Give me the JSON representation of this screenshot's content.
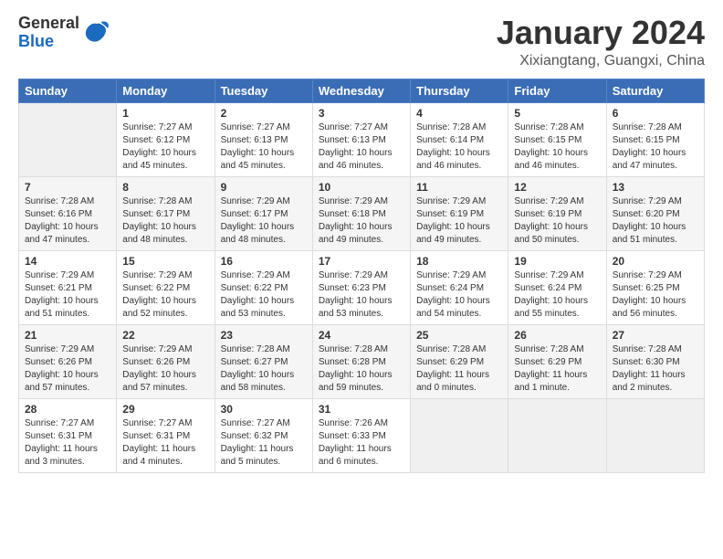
{
  "header": {
    "logo": {
      "line1": "General",
      "line2": "Blue"
    },
    "month_year": "January 2024",
    "location": "Xixiangtang, Guangxi, China"
  },
  "weekdays": [
    "Sunday",
    "Monday",
    "Tuesday",
    "Wednesday",
    "Thursday",
    "Friday",
    "Saturday"
  ],
  "weeks": [
    [
      {
        "num": "",
        "info": ""
      },
      {
        "num": "1",
        "info": "Sunrise: 7:27 AM\nSunset: 6:12 PM\nDaylight: 10 hours\nand 45 minutes."
      },
      {
        "num": "2",
        "info": "Sunrise: 7:27 AM\nSunset: 6:13 PM\nDaylight: 10 hours\nand 45 minutes."
      },
      {
        "num": "3",
        "info": "Sunrise: 7:27 AM\nSunset: 6:13 PM\nDaylight: 10 hours\nand 46 minutes."
      },
      {
        "num": "4",
        "info": "Sunrise: 7:28 AM\nSunset: 6:14 PM\nDaylight: 10 hours\nand 46 minutes."
      },
      {
        "num": "5",
        "info": "Sunrise: 7:28 AM\nSunset: 6:15 PM\nDaylight: 10 hours\nand 46 minutes."
      },
      {
        "num": "6",
        "info": "Sunrise: 7:28 AM\nSunset: 6:15 PM\nDaylight: 10 hours\nand 47 minutes."
      }
    ],
    [
      {
        "num": "7",
        "info": "Sunrise: 7:28 AM\nSunset: 6:16 PM\nDaylight: 10 hours\nand 47 minutes."
      },
      {
        "num": "8",
        "info": "Sunrise: 7:28 AM\nSunset: 6:17 PM\nDaylight: 10 hours\nand 48 minutes."
      },
      {
        "num": "9",
        "info": "Sunrise: 7:29 AM\nSunset: 6:17 PM\nDaylight: 10 hours\nand 48 minutes."
      },
      {
        "num": "10",
        "info": "Sunrise: 7:29 AM\nSunset: 6:18 PM\nDaylight: 10 hours\nand 49 minutes."
      },
      {
        "num": "11",
        "info": "Sunrise: 7:29 AM\nSunset: 6:19 PM\nDaylight: 10 hours\nand 49 minutes."
      },
      {
        "num": "12",
        "info": "Sunrise: 7:29 AM\nSunset: 6:19 PM\nDaylight: 10 hours\nand 50 minutes."
      },
      {
        "num": "13",
        "info": "Sunrise: 7:29 AM\nSunset: 6:20 PM\nDaylight: 10 hours\nand 51 minutes."
      }
    ],
    [
      {
        "num": "14",
        "info": "Sunrise: 7:29 AM\nSunset: 6:21 PM\nDaylight: 10 hours\nand 51 minutes."
      },
      {
        "num": "15",
        "info": "Sunrise: 7:29 AM\nSunset: 6:22 PM\nDaylight: 10 hours\nand 52 minutes."
      },
      {
        "num": "16",
        "info": "Sunrise: 7:29 AM\nSunset: 6:22 PM\nDaylight: 10 hours\nand 53 minutes."
      },
      {
        "num": "17",
        "info": "Sunrise: 7:29 AM\nSunset: 6:23 PM\nDaylight: 10 hours\nand 53 minutes."
      },
      {
        "num": "18",
        "info": "Sunrise: 7:29 AM\nSunset: 6:24 PM\nDaylight: 10 hours\nand 54 minutes."
      },
      {
        "num": "19",
        "info": "Sunrise: 7:29 AM\nSunset: 6:24 PM\nDaylight: 10 hours\nand 55 minutes."
      },
      {
        "num": "20",
        "info": "Sunrise: 7:29 AM\nSunset: 6:25 PM\nDaylight: 10 hours\nand 56 minutes."
      }
    ],
    [
      {
        "num": "21",
        "info": "Sunrise: 7:29 AM\nSunset: 6:26 PM\nDaylight: 10 hours\nand 57 minutes."
      },
      {
        "num": "22",
        "info": "Sunrise: 7:29 AM\nSunset: 6:26 PM\nDaylight: 10 hours\nand 57 minutes."
      },
      {
        "num": "23",
        "info": "Sunrise: 7:28 AM\nSunset: 6:27 PM\nDaylight: 10 hours\nand 58 minutes."
      },
      {
        "num": "24",
        "info": "Sunrise: 7:28 AM\nSunset: 6:28 PM\nDaylight: 10 hours\nand 59 minutes."
      },
      {
        "num": "25",
        "info": "Sunrise: 7:28 AM\nSunset: 6:29 PM\nDaylight: 11 hours\nand 0 minutes."
      },
      {
        "num": "26",
        "info": "Sunrise: 7:28 AM\nSunset: 6:29 PM\nDaylight: 11 hours\nand 1 minute."
      },
      {
        "num": "27",
        "info": "Sunrise: 7:28 AM\nSunset: 6:30 PM\nDaylight: 11 hours\nand 2 minutes."
      }
    ],
    [
      {
        "num": "28",
        "info": "Sunrise: 7:27 AM\nSunset: 6:31 PM\nDaylight: 11 hours\nand 3 minutes."
      },
      {
        "num": "29",
        "info": "Sunrise: 7:27 AM\nSunset: 6:31 PM\nDaylight: 11 hours\nand 4 minutes."
      },
      {
        "num": "30",
        "info": "Sunrise: 7:27 AM\nSunset: 6:32 PM\nDaylight: 11 hours\nand 5 minutes."
      },
      {
        "num": "31",
        "info": "Sunrise: 7:26 AM\nSunset: 6:33 PM\nDaylight: 11 hours\nand 6 minutes."
      },
      {
        "num": "",
        "info": ""
      },
      {
        "num": "",
        "info": ""
      },
      {
        "num": "",
        "info": ""
      }
    ]
  ]
}
